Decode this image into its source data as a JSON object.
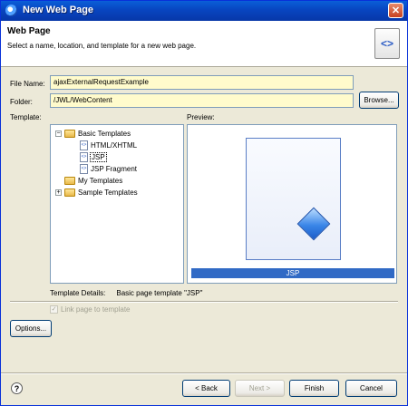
{
  "window": {
    "title": "New Web Page",
    "close_glyph": "✕"
  },
  "banner": {
    "heading": "Web Page",
    "description": "Select a name, location, and template for a new web page.",
    "icon_glyph": "<>"
  },
  "form": {
    "file_name_label": "File Name:",
    "file_name_value": "ajaxExternalRequestExample",
    "folder_label": "Folder:",
    "folder_value": "/JWL/WebContent",
    "browse_label": "Browse...",
    "template_label": "Template:",
    "preview_label": "Preview:"
  },
  "tree": {
    "items": [
      {
        "label": "Basic Templates",
        "expander": "−"
      },
      {
        "label": "HTML/XHTML"
      },
      {
        "label": "JSP"
      },
      {
        "label": "JSP Fragment"
      },
      {
        "label": "My Templates"
      },
      {
        "label": "Sample Templates",
        "expander": "+"
      }
    ]
  },
  "preview": {
    "caption": "JSP"
  },
  "details": {
    "label": "Template Details:",
    "value": "Basic page template \"JSP\""
  },
  "link_page": {
    "label": "Link page to template",
    "checked_glyph": "✓"
  },
  "options_label": "Options...",
  "footer": {
    "help_glyph": "?",
    "back_label": "< Back",
    "next_label": "Next >",
    "finish_label": "Finish",
    "cancel_label": "Cancel"
  }
}
